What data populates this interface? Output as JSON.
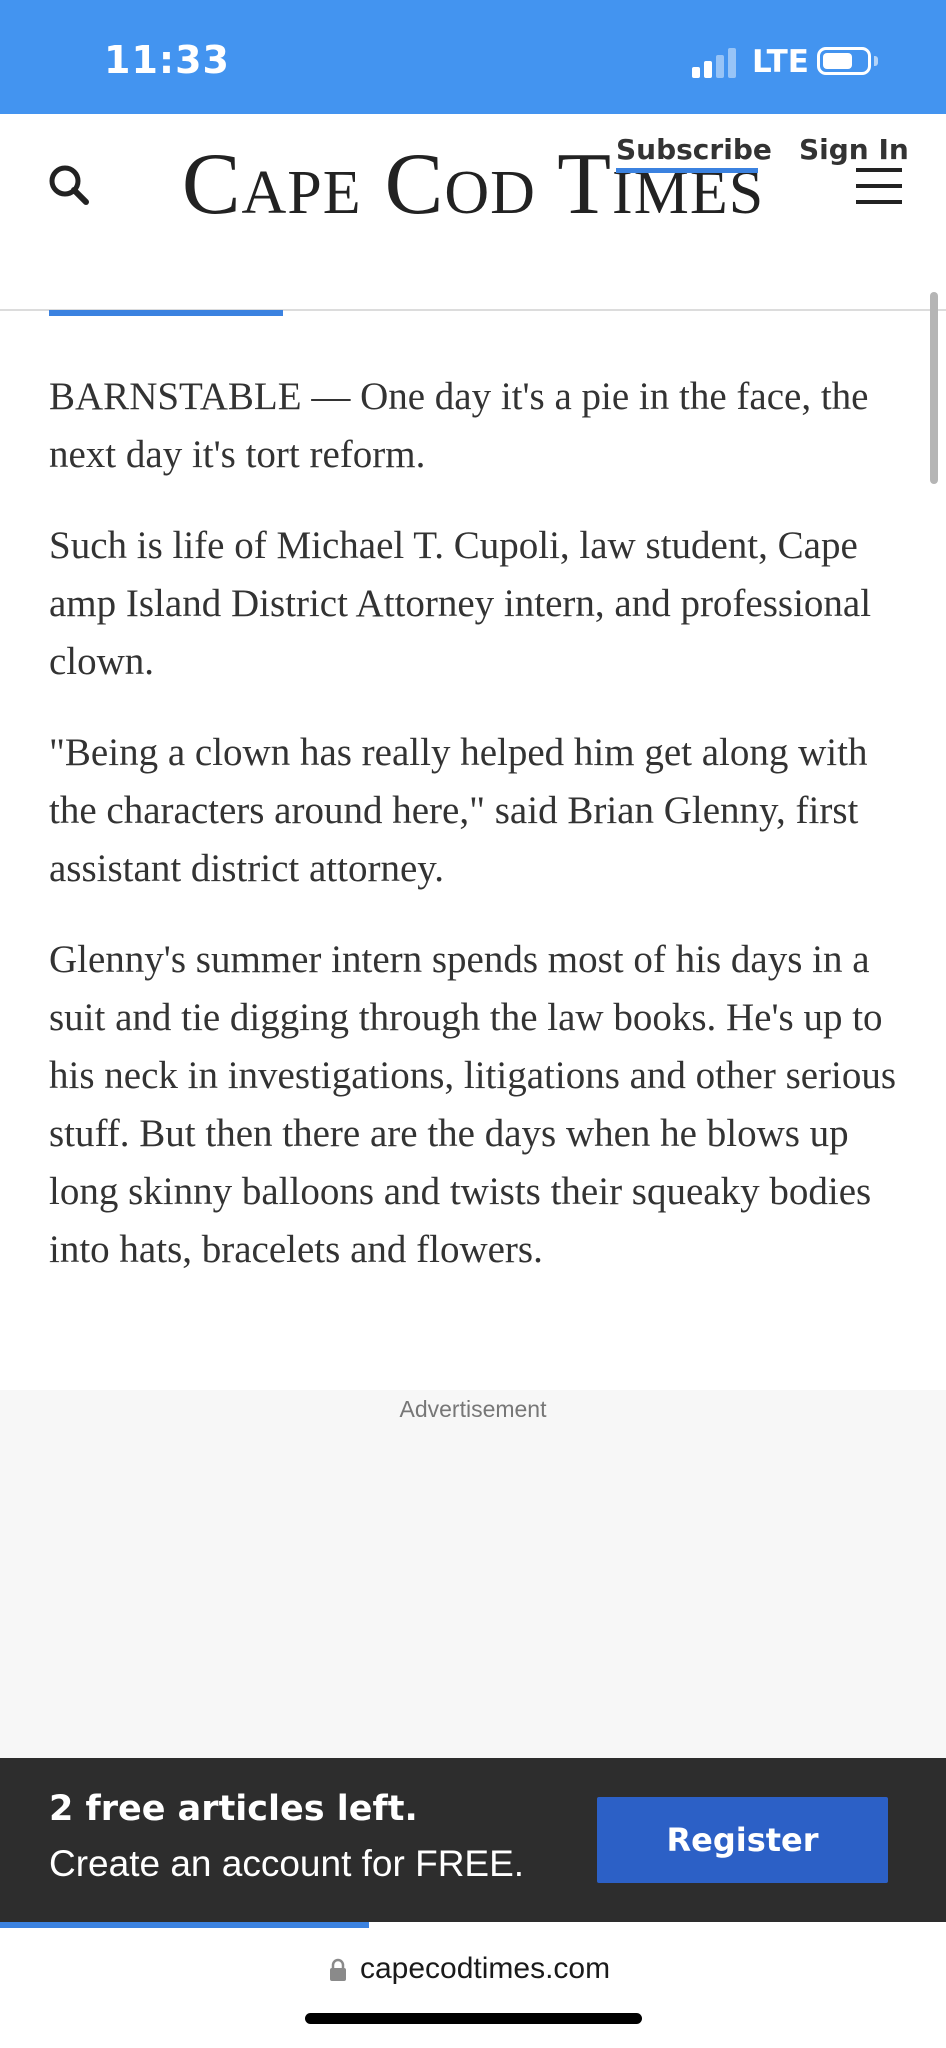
{
  "status_bar": {
    "time": "11:33",
    "network": "LTE",
    "signal_bars_active": 2,
    "signal_bars_total": 4,
    "battery_level": 0.7
  },
  "header": {
    "logo_text": "Cape Cod Times",
    "search_icon": "search-icon",
    "menu_icon": "hamburger-menu-icon",
    "subscribe_label": "Subscribe",
    "signin_label": "Sign In",
    "accent_color": "#3b82e0"
  },
  "article": {
    "paragraphs": [
      "BARNSTABLE — One day it's a pie in the face, the next day it's tort reform.",
      "Such is life of Michael T. Cupoli, law student, Cape amp Island District Attorney intern, and professional clown.",
      "\"Being a clown has really helped him get along with the characters around here,\" said Brian Glenny, first assistant district attorney.",
      "Glenny's summer intern spends most of his days in a suit and tie digging through the law books. He's up to his neck in investigations, litigations and other serious stuff. But then there are the days when he blows up long skinny balloons and twists their squeaky bodies into hats, bracelets and flowers."
    ]
  },
  "ad": {
    "label": "Advertisement"
  },
  "paywall": {
    "title": "2 free articles left.",
    "subtitle": "Create an account for FREE.",
    "register_label": "Register",
    "articles_read_fraction": 0.39,
    "button_color": "#2c60c6"
  },
  "browser": {
    "url": "capecodtimes.com",
    "lock_icon": "lock-icon"
  }
}
